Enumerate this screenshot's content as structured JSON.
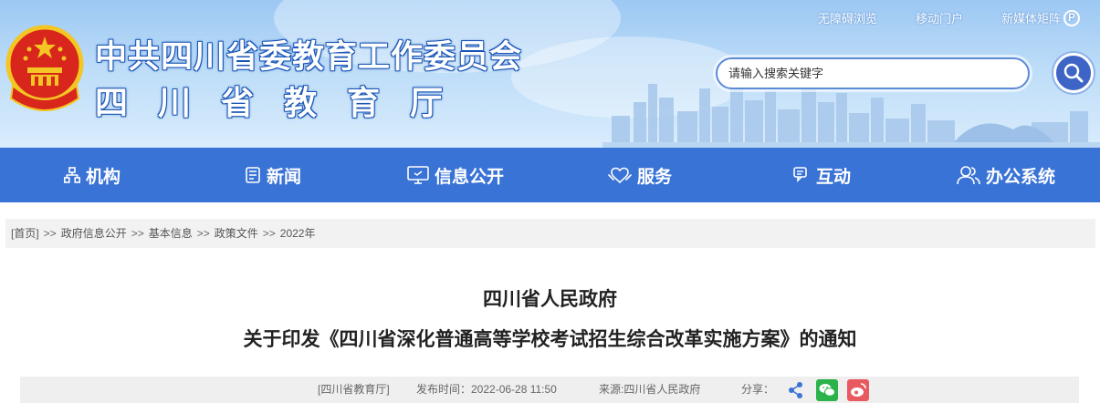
{
  "header": {
    "org_title": "中共四川省委教育工作委员会",
    "dept_title": "四川省教育厅",
    "top_links": [
      "无障碍浏览",
      "移动门户",
      "新媒体矩阵"
    ],
    "search_placeholder": "请输入搜索关键字"
  },
  "nav": {
    "items": [
      {
        "label": "机构",
        "icon": "org-chart-icon"
      },
      {
        "label": "新闻",
        "icon": "newspaper-icon"
      },
      {
        "label": "信息公开",
        "icon": "monitor-icon"
      },
      {
        "label": "服务",
        "icon": "handshake-icon"
      },
      {
        "label": "互动",
        "icon": "chat-icon"
      },
      {
        "label": "办公系统",
        "icon": "users-icon"
      }
    ]
  },
  "breadcrumb": [
    "[首页]",
    "政府信息公开",
    "基本信息",
    "政策文件",
    "2022年"
  ],
  "breadcrumb_sep": ">>",
  "article": {
    "title_line1": "四川省人民政府",
    "title_line2": "关于印发《四川省深化普通高等学校考试招生综合改革实施方案》的通知",
    "source_tag": "[四川省教育厅]",
    "publish_label": "发布时间：2022-06-28 11:50",
    "origin_label": "来源:四川省人民政府",
    "share_label": "分享："
  },
  "colors": {
    "nav_bg": "#3a73d6",
    "share_generic": "#3b75d4",
    "share_wechat": "#2bb34a",
    "share_weibo": "#e85a5f"
  }
}
